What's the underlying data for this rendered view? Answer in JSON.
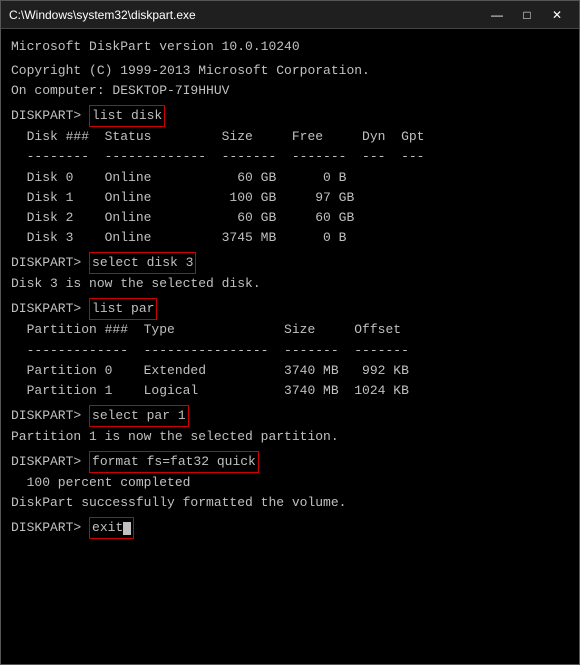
{
  "window": {
    "title": "C:\\Windows\\system32\\diskpart.exe",
    "minimize": "—",
    "maximize": "□",
    "close": "✕"
  },
  "console": {
    "version_line": "Microsoft DiskPart version 10.0.10240",
    "copyright_line": "Copyright (C) 1999-2013 Microsoft Corporation.",
    "computer_line": "On computer: DESKTOP-7I9HHUV",
    "cmd1": {
      "prompt": "DISKPART> ",
      "command": "list disk"
    },
    "disk_table_header": "  Disk ###  Status         Size     Free     Dyn  Gpt",
    "disk_table_sep": "  --------  -------------  -------  -------  ---  ---",
    "disk_rows": [
      "  Disk 0    Online           60 GB      0 B",
      "  Disk 1    Online          100 GB     97 GB",
      "  Disk 2    Online           60 GB     60 GB",
      "  Disk 3    Online         3745 MB      0 B"
    ],
    "cmd2": {
      "prompt": "DISKPART> ",
      "command": "select disk 3"
    },
    "select_disk_result": "Disk 3 is now the selected disk.",
    "cmd3": {
      "prompt": "DISKPART> ",
      "command": "list par"
    },
    "par_table_header": "  Partition ###  Type              Size     Offset",
    "par_table_sep": "  -------------  ----------------  -------  -------",
    "par_rows": [
      "  Partition 0    Extended          3740 MB   992 KB",
      "  Partition 1    Logical           3740 MB  1024 KB"
    ],
    "cmd4": {
      "prompt": "DISKPART> ",
      "command": "select par 1"
    },
    "select_par_result": "Partition 1 is now the selected partition.",
    "cmd5": {
      "prompt": "DISKPART> ",
      "command": "format fs=fat32 quick"
    },
    "format_result": "  100 percent completed",
    "format_success": "DiskPart successfully formatted the volume.",
    "cmd6": {
      "prompt": "DISKPART> ",
      "command": "exit",
      "cursor": true
    }
  }
}
